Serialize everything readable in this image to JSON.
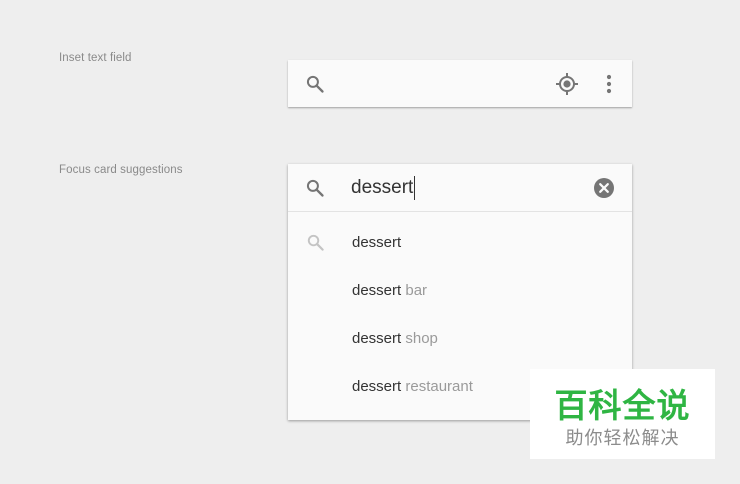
{
  "labels": {
    "inset_text_field": "Inset text field",
    "focus_card_suggestions": "Focus card suggestions"
  },
  "inset_bar": {
    "icons": [
      "search-icon",
      "my-location-icon",
      "more-vert-icon"
    ]
  },
  "focus_card": {
    "query": "dessert",
    "icons": [
      "search-icon",
      "clear-icon",
      "history-search-icon"
    ],
    "suggestions": [
      {
        "main": "dessert",
        "rest": ""
      },
      {
        "main": "dessert",
        "rest": " bar"
      },
      {
        "main": "dessert",
        "rest": " shop"
      },
      {
        "main": "dessert",
        "rest": " restaurant"
      }
    ]
  },
  "watermark": {
    "title": "百科全说",
    "subtitle": "助你轻松解决"
  },
  "colors": {
    "background": "#eeeeee",
    "card": "#fafafa",
    "icon": "#757575",
    "hint_text": "#9a9a9a",
    "watermark_green": "#2fb543"
  }
}
